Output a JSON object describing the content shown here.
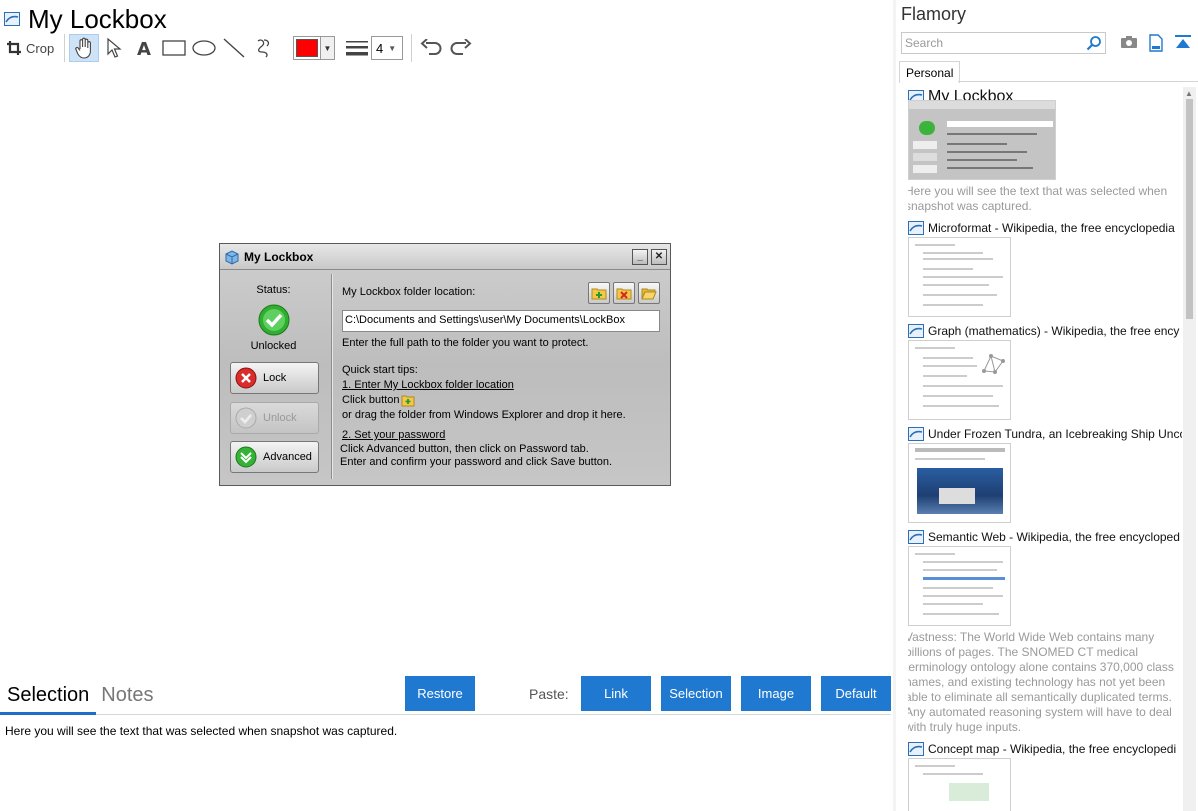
{
  "editor": {
    "title": "My Lockbox",
    "toolbar": {
      "crop_label": "Crop",
      "tools": [
        "hand-tool",
        "select-tool",
        "text-tool",
        "rectangle-tool",
        "ellipse-tool",
        "line-tool",
        "freehand-tool"
      ],
      "color": "#ff0000",
      "line_width": "4"
    }
  },
  "dialog": {
    "title": "My Lockbox",
    "status_label": "Status:",
    "status_value": "Unlocked",
    "buttons": {
      "lock": "Lock",
      "unlock": "Unlock",
      "advanced": "Advanced"
    },
    "folder_location_label": "My Lockbox folder location:",
    "path": "C:\\Documents and Settings\\user\\My Documents\\LockBox",
    "hint": "Enter the full path to the folder you want to protect.",
    "tips": {
      "heading": "Quick start tips:",
      "step1": "1. Enter My Lockbox folder location",
      "click_button": "Click button",
      "drag": "or drag the folder from Windows Explorer and drop it here.",
      "step2": "2. Set your password",
      "line_a": "Click Advanced button, then click on Password tab.",
      "line_b": "Enter and confirm your password and click Save button."
    }
  },
  "selection_panel": {
    "tabs": [
      "Selection",
      "Notes"
    ],
    "restore": "Restore",
    "paste_label": "Paste:",
    "paste_buttons": [
      "Link",
      "Selection",
      "Image",
      "Default"
    ],
    "text": "Here you will see the text that was selected when snapshot was captured."
  },
  "flamory": {
    "title": "Flamory",
    "search_placeholder": "Search",
    "tab": "Personal",
    "accent": "#1f79d1",
    "items": [
      {
        "title": "My Lockbox",
        "snippet": "Here you will see the text that was selected when snapshot was captured."
      },
      {
        "title": "Microformat - Wikipedia, the free encyclopedia"
      },
      {
        "title": "Graph (mathematics) - Wikipedia, the free ency"
      },
      {
        "title": "Under Frozen Tundra, an Icebreaking Ship Unco"
      },
      {
        "title": "Semantic Web - Wikipedia, the free encycloped",
        "snippet": "Vastness: The World Wide Web contains many billions of pages. The SNOMED CT medical terminology ontology alone contains 370,000 class names, and existing technology has not yet been able to eliminate all semantically duplicated terms. Any automated reasoning system will have to deal with truly huge inputs."
      },
      {
        "title": "Concept map - Wikipedia, the free encyclopedi"
      }
    ]
  }
}
